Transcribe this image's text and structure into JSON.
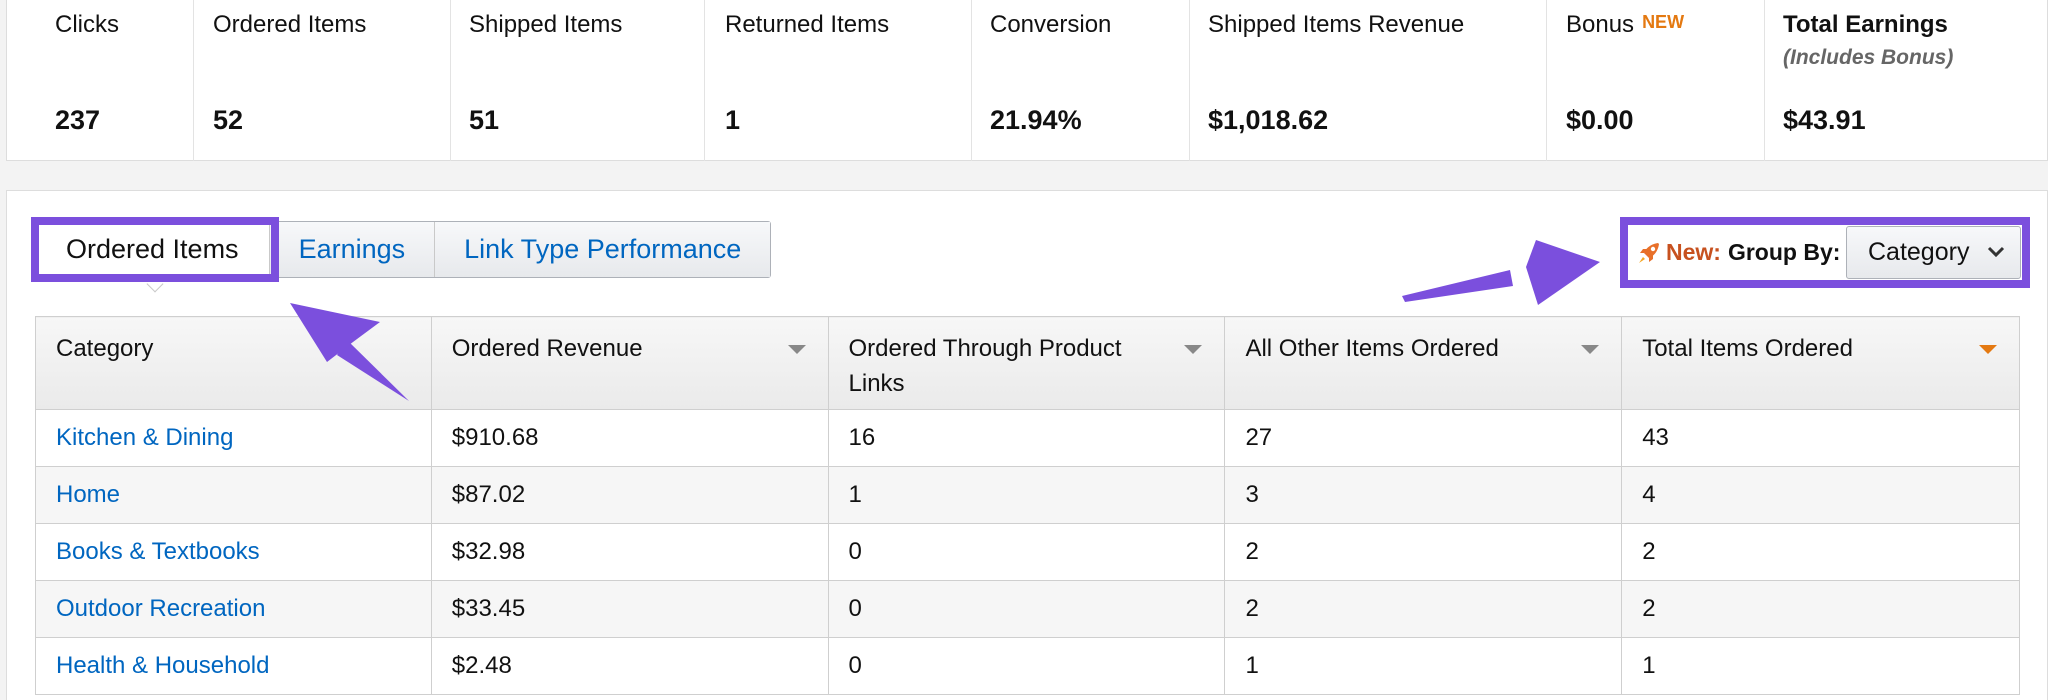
{
  "summary": {
    "clicks": {
      "label": "Clicks",
      "value": "237"
    },
    "ordered": {
      "label": "Ordered Items",
      "value": "52"
    },
    "shipped": {
      "label": "Shipped Items",
      "value": "51"
    },
    "returned": {
      "label": "Returned Items",
      "value": "1"
    },
    "conversion": {
      "label": "Conversion",
      "value": "21.94%"
    },
    "revenue": {
      "label": "Shipped Items Revenue",
      "value": "$1,018.62"
    },
    "bonus": {
      "label": "Bonus",
      "badge": "NEW",
      "value": "$0.00"
    },
    "total": {
      "label": "Total Earnings",
      "sublabel": "(Includes Bonus)",
      "value": "$43.91"
    }
  },
  "tabs": [
    "Ordered Items",
    "Earnings",
    "Link Type Performance"
  ],
  "group_by": {
    "new_label": "New:",
    "label": "Group By:",
    "selected": "Category",
    "icon": "rocket-icon"
  },
  "table": {
    "headers": [
      "Category",
      "Ordered Revenue",
      "Ordered Through Product Links",
      "All Other Items Ordered",
      "Total Items Ordered"
    ],
    "rows": [
      [
        "Kitchen & Dining",
        "$910.68",
        "16",
        "27",
        "43"
      ],
      [
        "Home",
        "$87.02",
        "1",
        "3",
        "4"
      ],
      [
        "Books & Textbooks",
        "$32.98",
        "0",
        "2",
        "2"
      ],
      [
        "Outdoor Recreation",
        "$33.45",
        "0",
        "2",
        "2"
      ],
      [
        "Health & Household",
        "$2.48",
        "0",
        "1",
        "1"
      ]
    ]
  },
  "colors": {
    "link": "#0066c0",
    "highlight": "#7b4fdd",
    "accent_orange": "#e47911"
  }
}
